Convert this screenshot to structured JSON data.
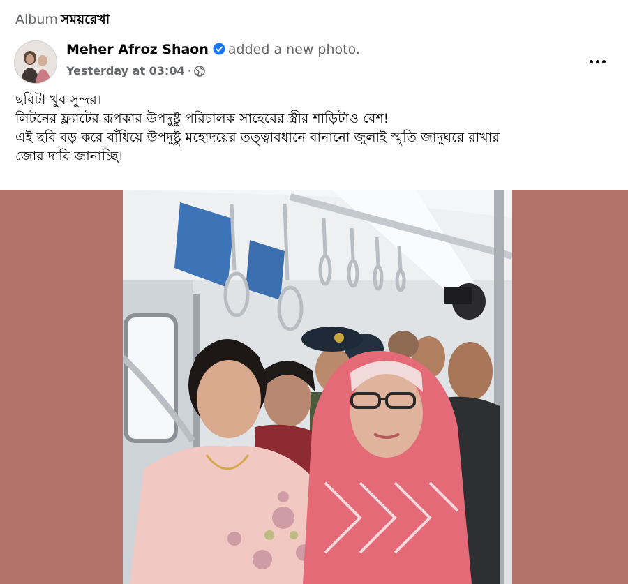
{
  "album": {
    "prefix": "Album",
    "name": "সময়রেখা"
  },
  "post": {
    "author": "Meher Afroz Shaon",
    "action": "added a new photo.",
    "timestamp": "Yesterday at 03:04",
    "separator": "·",
    "privacy_icon": "globe-icon",
    "more_icon": "more-horizontal-icon",
    "verified_icon": "verified-badge-icon",
    "text_lines": [
      "ছবিটা খুব সুন্দর।",
      "লিটনের ফ্ল্যাটের রূপকার উপদুষ্টু পরিচালক সাহেবের স্ত্রীর শাড়িটাও বেশ!",
      "এই ছবি বড় করে বাঁধিয়ে উপদুষ্টু মহোদয়ের তত্ত্বাবধানে বানানো জুলাই স্মৃতি জাদুঘরে রাখার",
      "জোর দাবি জানাচ্ছি।"
    ]
  },
  "colors": {
    "verified": "#1877f2",
    "photo_backdrop": "#b3736a",
    "secondary_text": "#65676b"
  }
}
